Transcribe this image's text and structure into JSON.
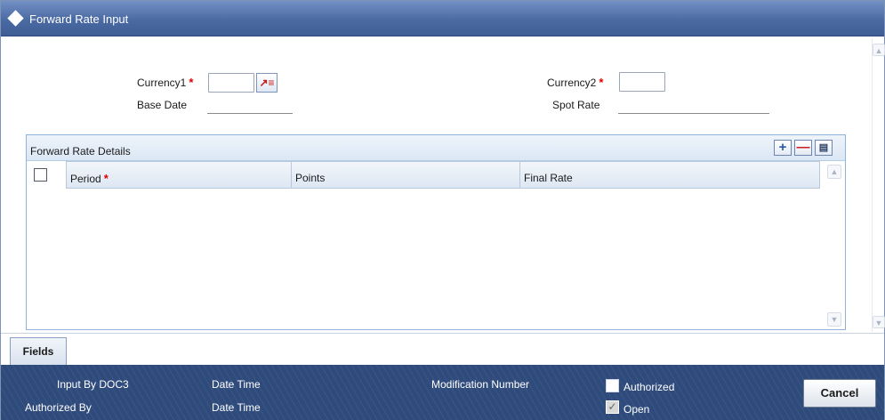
{
  "window": {
    "title": "Forward Rate Input"
  },
  "header_fields": {
    "currency1_label": "Currency1",
    "currency1_value": "",
    "currency2_label": "Currency2",
    "currency2_value": "",
    "base_date_label": "Base Date",
    "base_date_value": "",
    "spot_rate_label": "Spot Rate",
    "spot_rate_value": "",
    "required_marker": "*"
  },
  "grid": {
    "title": "Forward Rate Details",
    "columns": [
      "Period",
      "Points",
      "Final Rate"
    ],
    "rows": []
  },
  "tabs": {
    "fields": "Fields"
  },
  "footer": {
    "input_by_label": "Input By DOC3",
    "authorized_by_label": "Authorized By",
    "date_time_label_1": "Date Time",
    "date_time_label_2": "Date Time",
    "modification_number_label": "Modification Number",
    "authorized_label": "Authorized",
    "authorized_checked": false,
    "open_label": "Open",
    "open_checked": true,
    "cancel_label": "Cancel"
  },
  "icons": {
    "title": "diamond-icon",
    "lov": "list-of-values-icon",
    "add": "plus-icon",
    "delete": "minus-icon",
    "view": "list-view-icon"
  },
  "colors": {
    "title_bar": "#4a6aa3",
    "footer": "#2f4b7c",
    "required": "#e00000"
  }
}
